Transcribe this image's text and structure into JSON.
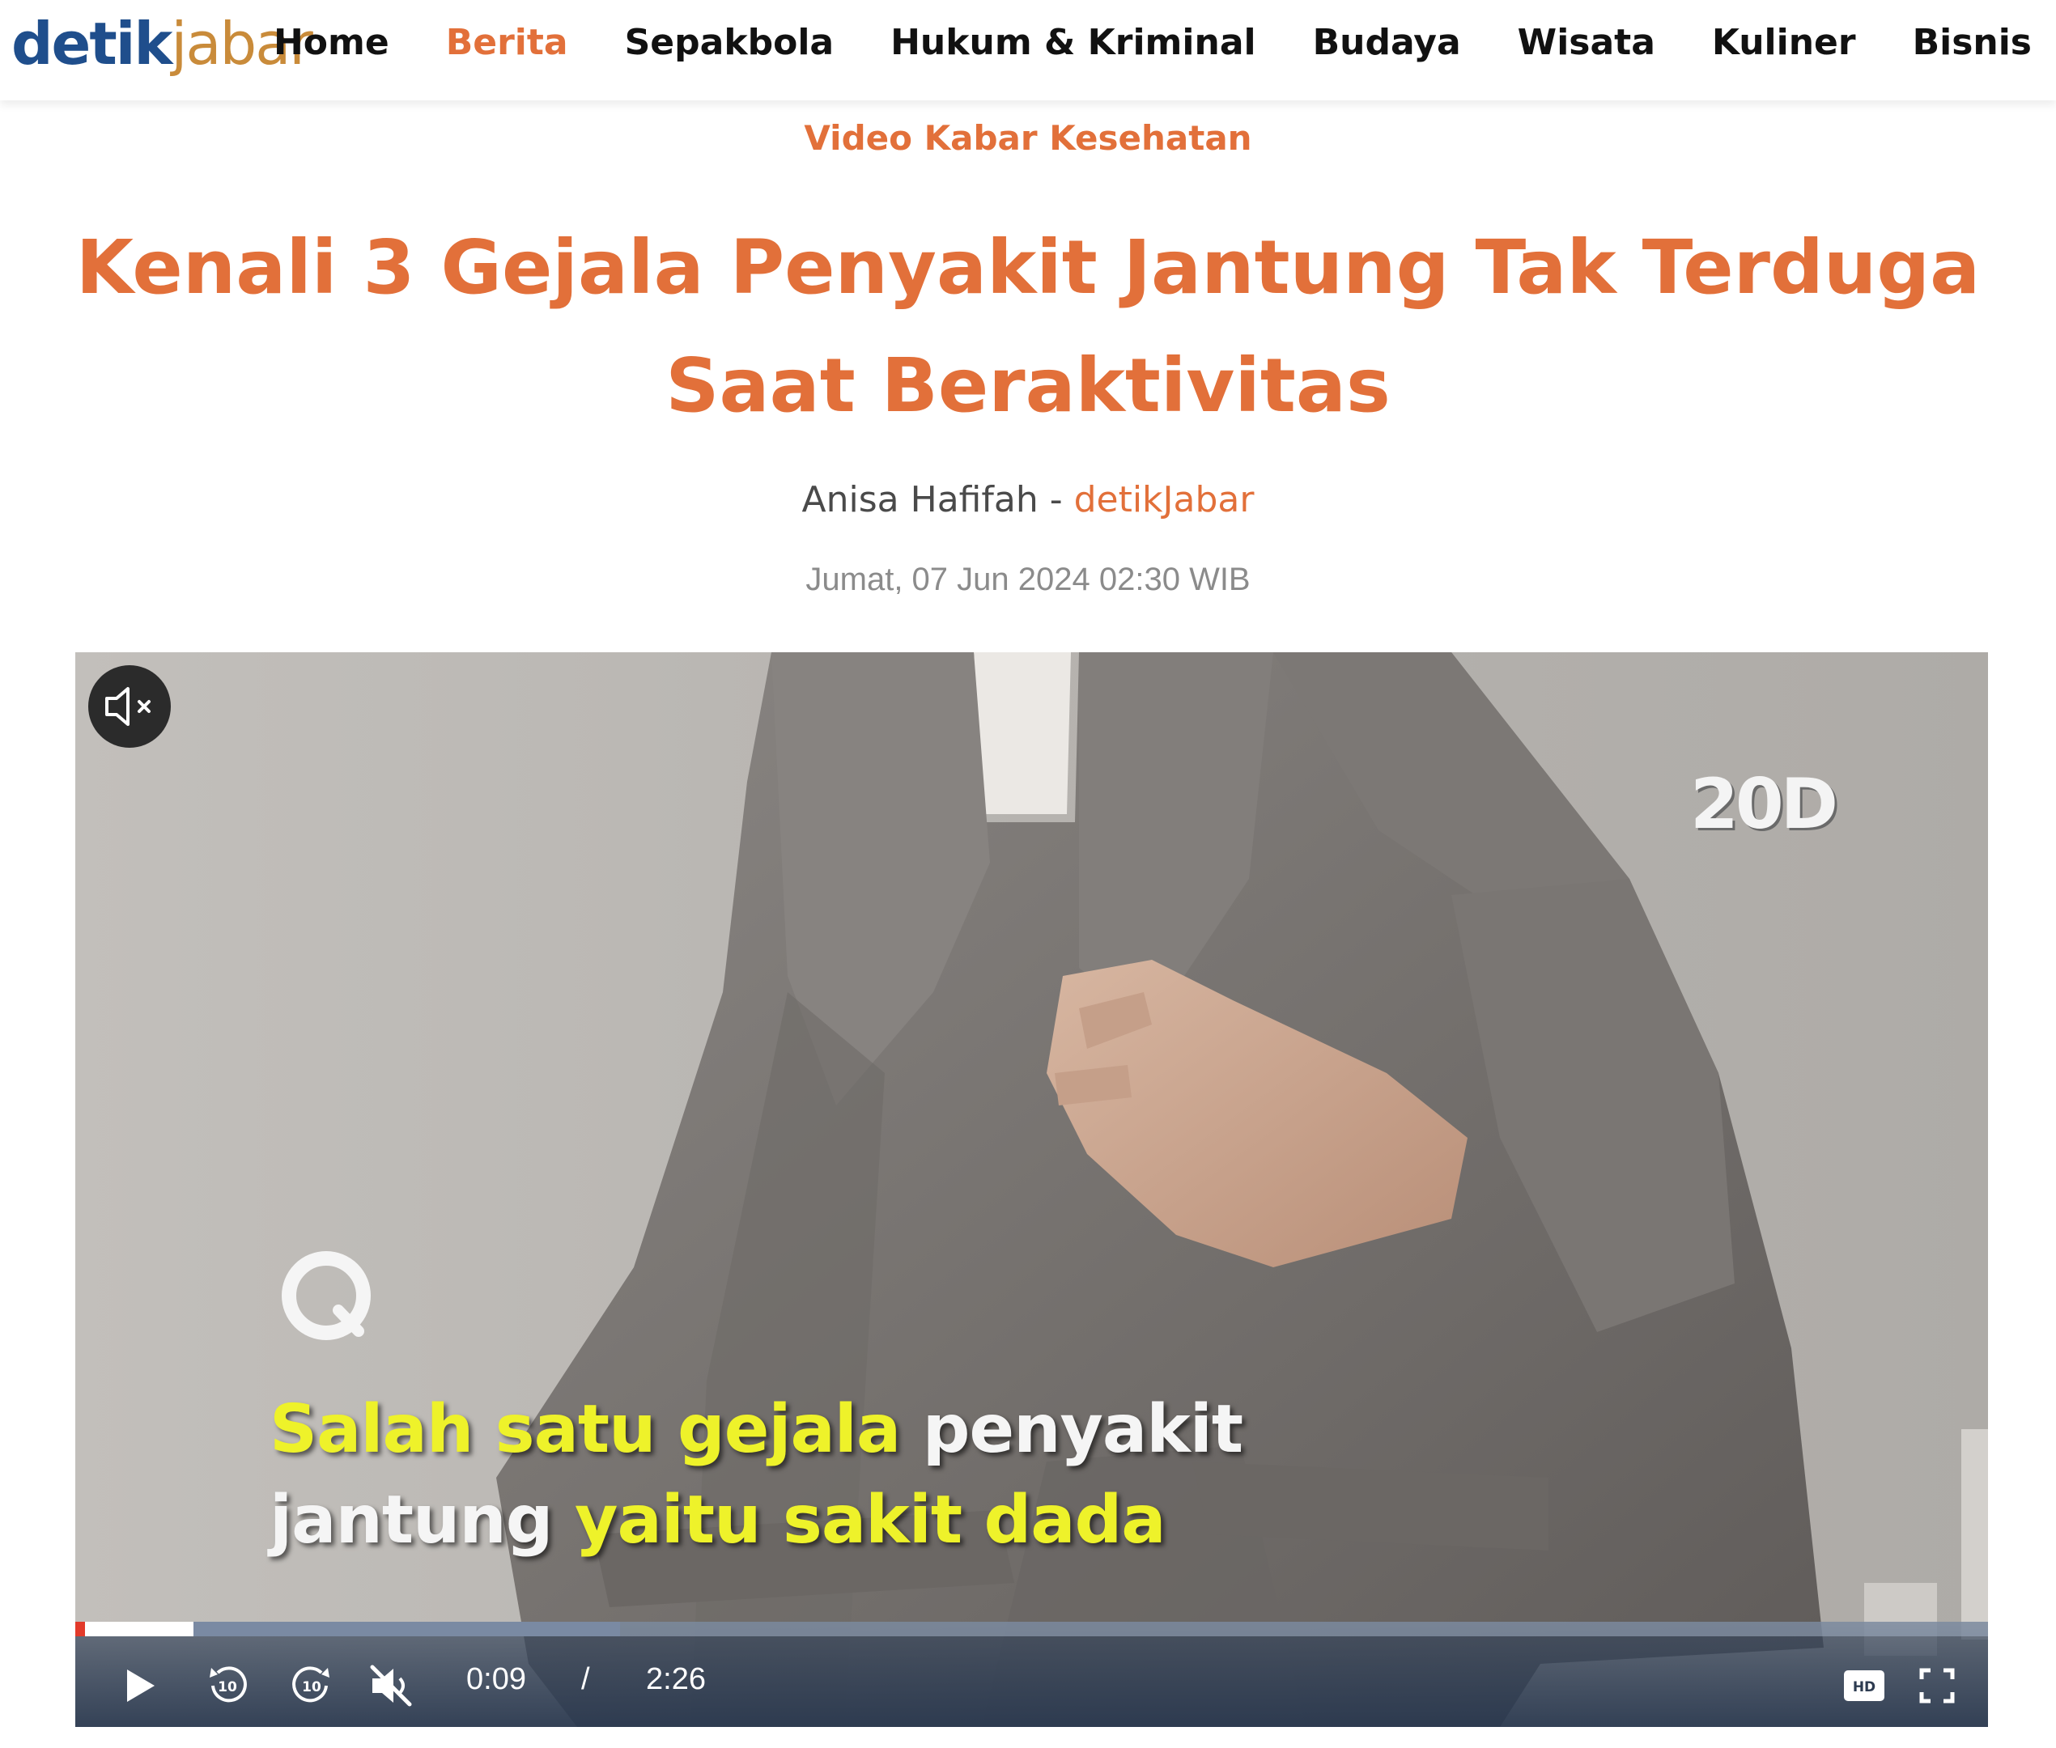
{
  "header": {
    "logo_part1": "detik",
    "logo_part2": "jabar",
    "nav": [
      {
        "label": "Home",
        "active": false
      },
      {
        "label": "Berita",
        "active": true
      },
      {
        "label": "Sepakbola",
        "active": false
      },
      {
        "label": "Hukum & Kriminal",
        "active": false
      },
      {
        "label": "Budaya",
        "active": false
      },
      {
        "label": "Wisata",
        "active": false
      },
      {
        "label": "Kuliner",
        "active": false
      },
      {
        "label": "Bisnis",
        "active": false
      }
    ]
  },
  "article": {
    "kicker": "Video Kabar Kesehatan",
    "title": "Kenali 3 Gejala Penyakit Jantung Tak Terduga Saat Beraktivitas",
    "author": "Anisa Hafifah",
    "separator": " - ",
    "source": "detikJabar",
    "date": "Jumat, 07 Jun 2024 02:30 WIB"
  },
  "video": {
    "watermark": "20D",
    "caption_line1": [
      {
        "text": "Salah satu gejala ",
        "highlight": true
      },
      {
        "text": "penyakit",
        "highlight": false
      }
    ],
    "caption_line2": [
      {
        "text": "jantung ",
        "highlight": false
      },
      {
        "text": "yaitu sakit dada",
        "highlight": true
      }
    ],
    "current_time": "0:09",
    "time_separator": "/",
    "duration": "2:26",
    "played_fraction": 0.0616,
    "buffered_fraction": 0.285,
    "quality_label": "HD",
    "muted": true,
    "icons": {
      "mute_badge": "speaker-muted-icon",
      "play": "play-icon",
      "rewind": "rewind-10-icon",
      "forward": "forward-10-icon",
      "volume": "volume-muted-icon",
      "quality": "hd-icon",
      "fullscreen": "fullscreen-icon"
    },
    "colors": {
      "accent": "#e2703a",
      "caption_highlight": "#eef22a",
      "progress_head": "#e23a2a"
    }
  }
}
